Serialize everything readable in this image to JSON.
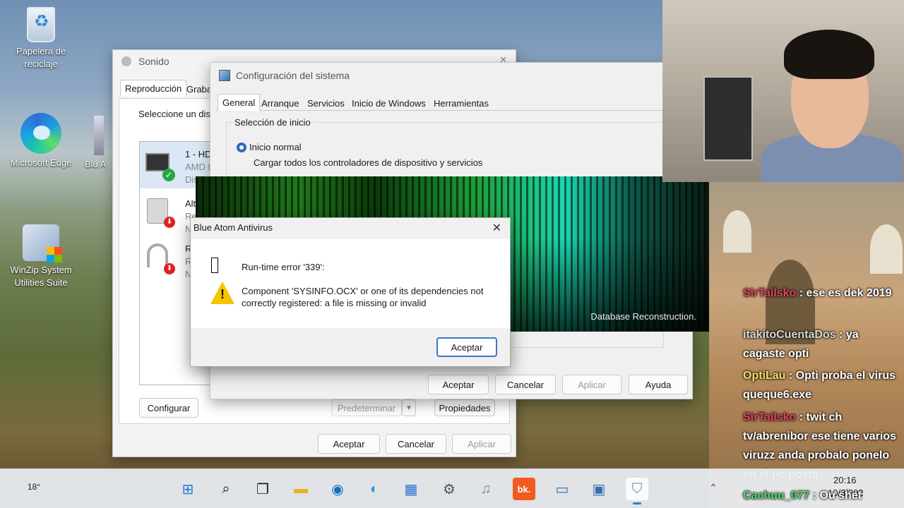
{
  "desktop": {
    "icons": [
      {
        "label": "Papelera de reciclaje",
        "icon": "recycle-bin-icon"
      },
      {
        "label": "Microsoft Edge",
        "icon": "edge-icon"
      },
      {
        "label": "WinZip System Utilities Suite",
        "icon": "winzip-icon"
      },
      {
        "label": "Blu A",
        "icon": "app-icon"
      }
    ]
  },
  "sonido": {
    "title": "Sonido",
    "tabs": [
      "Reproducción",
      "Graba"
    ],
    "prompt": "Seleccione un disp",
    "devices": [
      {
        "name": "1 - HD",
        "detail": "AMD H",
        "status": "Disp"
      },
      {
        "name": "Alt",
        "detail": "Re",
        "status": "N"
      },
      {
        "name": "R",
        "detail": "R",
        "status": "N"
      }
    ],
    "configure": "Configurar",
    "set_default": "Predeterminar",
    "properties": "Propiedades",
    "ok": "Aceptar",
    "cancel": "Cancelar",
    "apply": "Aplicar"
  },
  "config": {
    "title": "Configuración del sistema",
    "tabs": [
      "General",
      "Arranque",
      "Servicios",
      "Inicio de Windows",
      "Herramientas"
    ],
    "section": "Selección de inicio",
    "option": "Inicio normal",
    "option_desc": "Cargar todos los controladores de dispositivo y servicios",
    "ok": "Aceptar",
    "cancel": "Cancelar",
    "apply": "Aplicar",
    "help": "Ayuda"
  },
  "splash": {
    "label": "Database Reconstruction."
  },
  "error_dialog": {
    "title": "Blue Atom Antivirus",
    "heading": "Run-time error '339':",
    "message_line1": "Component 'SYSINFO.OCX' or one of its dependencies not",
    "message_line2": "correctly registered: a file is missing or invalid",
    "ok": "Aceptar",
    "close": "✕"
  },
  "chat": [
    {
      "user": "SirTailsko",
      "text": ": ese es dek 2019"
    },
    {
      "user": "itakitoCuentaDos",
      "text": ": ya cagaste opti"
    },
    {
      "user": "OptiLau",
      "text": ": Opti proba el virus queque6.exe"
    },
    {
      "user": "SirTailsko",
      "text": ": twit ch tv/abrenibor ese tiene varios viruzz anda probalo ponelo en el pc posta"
    },
    {
      "user": "Cachuu_077",
      "text": ": Ou shet"
    }
  ],
  "taskbar": {
    "weather": "18°",
    "time": "20:16",
    "date": "10/3/202",
    "apps": [
      "windows-start-icon",
      "search-icon",
      "task-view-icon",
      "file-explorer-icon",
      "teamviewer-icon",
      "edge-icon",
      "store-icon",
      "settings-icon",
      "sound-icon",
      "bk-app-icon",
      "monitor-icon",
      "system-config-icon",
      "antivirus-icon"
    ]
  }
}
